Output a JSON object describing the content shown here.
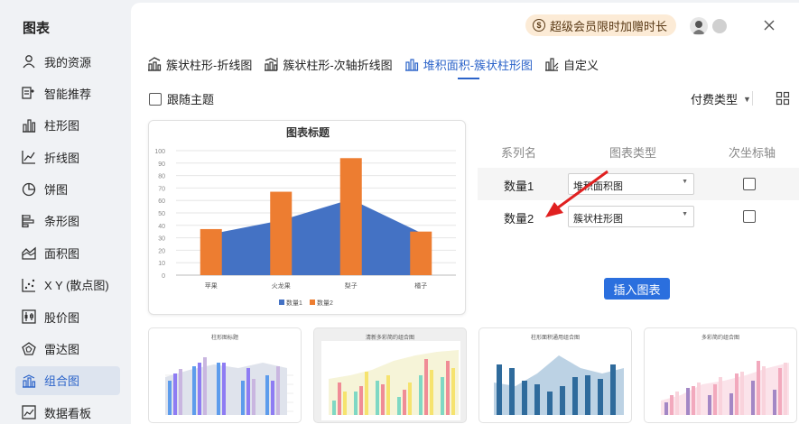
{
  "sidebar": {
    "title": "图表",
    "items": [
      {
        "label": "我的资源",
        "icon": "user-icon"
      },
      {
        "label": "智能推荐",
        "icon": "smart-recommend-icon"
      },
      {
        "label": "柱形图",
        "icon": "column-chart-icon"
      },
      {
        "label": "折线图",
        "icon": "line-chart-icon"
      },
      {
        "label": "饼图",
        "icon": "pie-chart-icon"
      },
      {
        "label": "条形图",
        "icon": "bar-chart-icon"
      },
      {
        "label": "面积图",
        "icon": "area-chart-icon"
      },
      {
        "label": "X Y (散点图)",
        "icon": "scatter-chart-icon"
      },
      {
        "label": "股价图",
        "icon": "stock-chart-icon"
      },
      {
        "label": "雷达图",
        "icon": "radar-chart-icon"
      },
      {
        "label": "组合图",
        "icon": "combo-chart-icon",
        "active": true
      },
      {
        "label": "数据看板",
        "icon": "dashboard-icon"
      }
    ]
  },
  "header": {
    "vip_label": "超级会员限时加赠时长",
    "vip_icon_text": "$"
  },
  "tabs": [
    {
      "label": "簇状柱形-折线图",
      "icon": "column-line-combo-icon"
    },
    {
      "label": "簇状柱形-次轴折线图",
      "icon": "column-secondary-line-icon"
    },
    {
      "label": "堆积面积-簇状柱形图",
      "icon": "stacked-area-column-icon",
      "active": true
    },
    {
      "label": "自定义",
      "icon": "custom-chart-icon"
    }
  ],
  "options": {
    "follow_theme_label": "跟随主题",
    "follow_theme_checked": false,
    "paid_type_label": "付费类型"
  },
  "series_panel": {
    "headers": {
      "name": "系列名",
      "type": "图表类型",
      "secondary": "次坐标轴"
    },
    "rows": [
      {
        "name": "数量1",
        "type": "堆积面积图",
        "secondary": false
      },
      {
        "name": "数量2",
        "type": "簇状柱形图",
        "secondary": false
      }
    ],
    "insert_label": "插入图表"
  },
  "chart_data": {
    "type": "bar",
    "title": "图表标题",
    "categories": [
      "苹果",
      "火龙果",
      "梨子",
      "橘子"
    ],
    "ylim": [
      0,
      100
    ],
    "yticks": [
      0,
      10,
      20,
      30,
      40,
      50,
      60,
      70,
      80,
      90,
      100
    ],
    "grid": true,
    "legend_position": "bottom",
    "series": [
      {
        "name": "数量1",
        "chart": "area",
        "color": "#4472c4",
        "values": [
          33,
          44,
          61,
          34
        ]
      },
      {
        "name": "数量2",
        "chart": "bar",
        "color": "#ed7d31",
        "values": [
          37,
          67,
          94,
          35
        ]
      }
    ]
  },
  "thumbnails": [
    {
      "title": "柱形图标题"
    },
    {
      "title": "清新多彩简约组合图"
    },
    {
      "title": "柱形面积通用组合图"
    },
    {
      "title": "多彩简约组合图"
    }
  ]
}
